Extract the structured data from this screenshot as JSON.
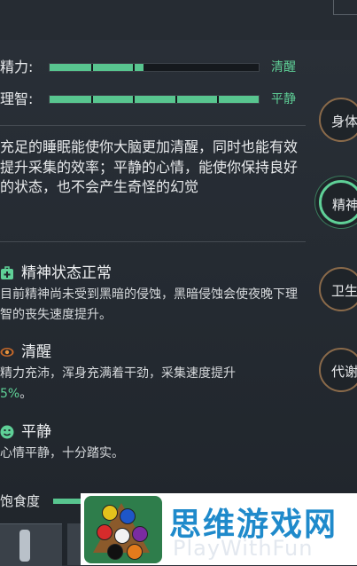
{
  "stats": [
    {
      "label": "精力:",
      "value": "清醒",
      "fill_pct": 45,
      "segments": 5
    },
    {
      "label": "理智:",
      "value": "平静",
      "fill_pct": 100,
      "segments": 5
    }
  ],
  "description": "充足的睡眠能使你大脑更加清醒，同时也能有效提升采集的效率；平静的心情，能使你保持良好的状态，也不会产生奇怪的幻觉",
  "statuses": [
    {
      "icon": "medkit-icon",
      "title": "精神状态正常",
      "text": "目前精神尚未受到黑暗的侵蚀，黑暗侵蚀会使夜晚下理智的丧失速度提升。",
      "highlight": "",
      "text_after": ""
    },
    {
      "icon": "eye-icon",
      "title": "清醒",
      "text": "精力充沛，浑身充满着干劲，采集速度提升",
      "highlight": "5%",
      "text_after": "。"
    },
    {
      "icon": "smile-icon",
      "title": "平静",
      "text": "心情平静，十分踏实。",
      "highlight": "",
      "text_after": ""
    }
  ],
  "side_tabs": [
    {
      "label": "身体",
      "active": false
    },
    {
      "label": "精神",
      "active": true
    },
    {
      "label": "卫生",
      "active": false
    },
    {
      "label": "代谢",
      "active": false
    }
  ],
  "hunger": {
    "label": "饱食度",
    "fill_pct": 20
  },
  "banner": {
    "title": "思维游戏网",
    "subtitle": "PlayWithFun"
  },
  "colors": {
    "accent": "#5fd097",
    "bar": "#58c58f",
    "background": "#262c33"
  }
}
